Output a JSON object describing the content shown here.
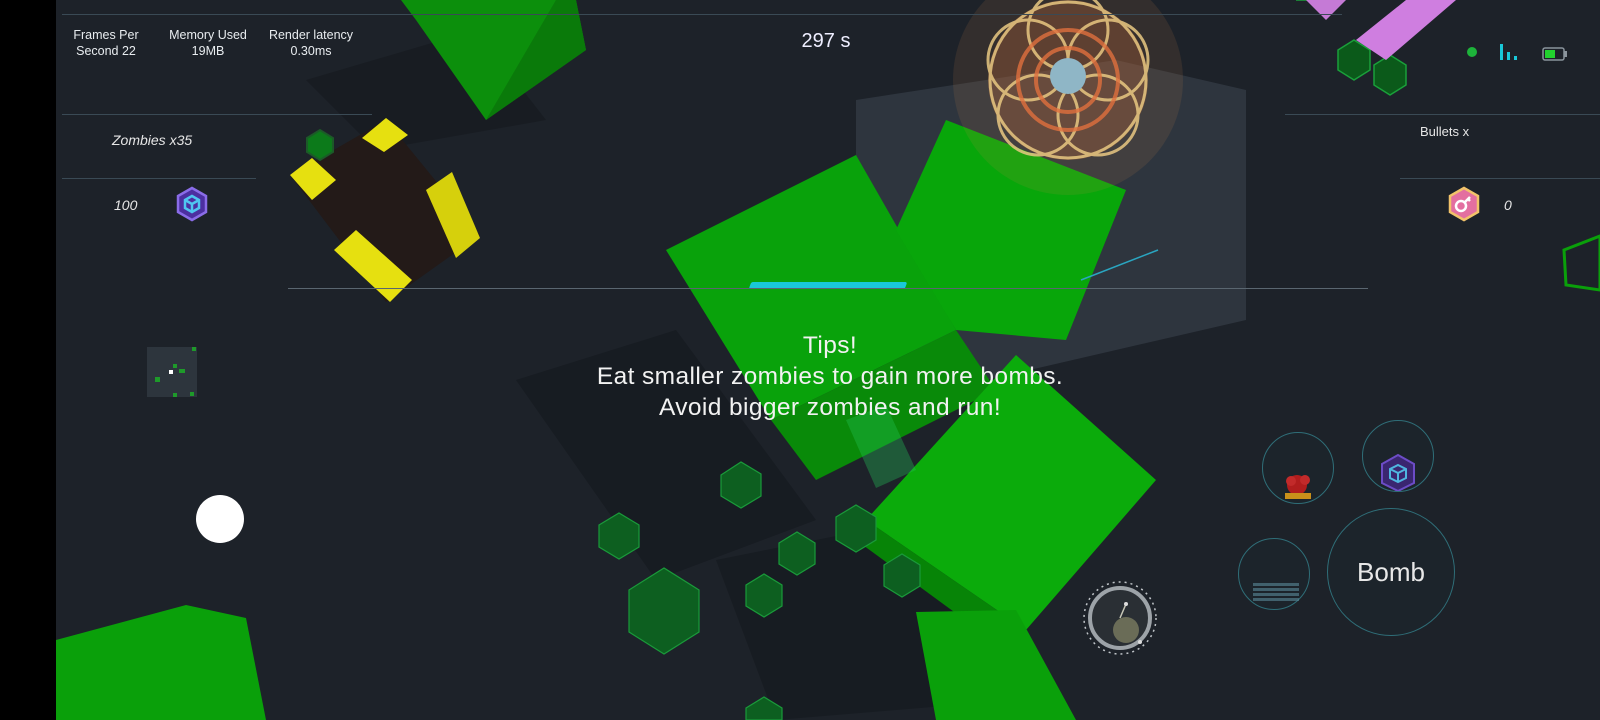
{
  "hud": {
    "fps_label": "Frames Per",
    "fps_value": "Second 22",
    "memory_label": "Memory Used",
    "memory_value": "19MB",
    "latency_label": "Render latency",
    "latency_value": "0.30ms",
    "timer": "297 s"
  },
  "left_panel": {
    "zombies": "Zombies x35",
    "score": "100",
    "icon": "blue-cube-hex-icon"
  },
  "right_panel": {
    "bullets": "Bullets x",
    "count": "0",
    "icon": "key-hex-icon"
  },
  "tips": {
    "title": "Tips!",
    "line1": "Eat smaller zombies to gain more bombs.",
    "line2": "Avoid bigger zombies and run!"
  },
  "loading_progress": 1.0,
  "controls": {
    "bomb_label": "Bomb",
    "skill1_icon": "red-splat-icon",
    "skill2_icon": "cube-hex-icon",
    "skill3_icon": "grid-dots-icon",
    "aim_icon": "crosshair-dial-icon"
  },
  "status_icons": [
    "green-dot-icon",
    "signal-bars-icon",
    "battery-icon"
  ],
  "colors": {
    "background": "#1d2229",
    "zombie_green": "#0da70d",
    "accent_cyan": "#19c8d8",
    "yellow_block": "#e6e010",
    "panel_line": "#3a4a55"
  }
}
